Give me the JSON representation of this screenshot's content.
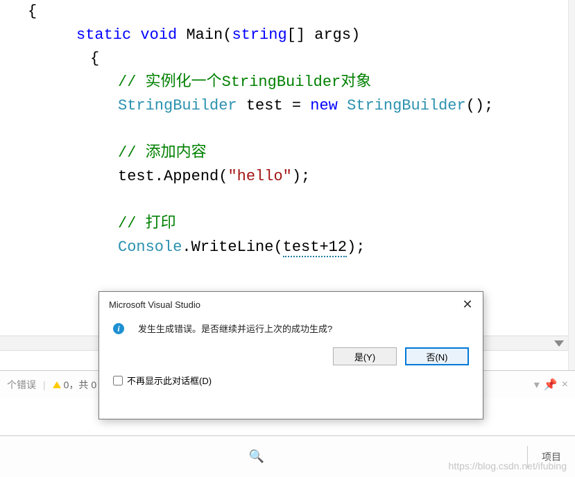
{
  "code": {
    "l1": "{",
    "kw_static": "static",
    "kw_void": "void",
    "fn_main": "Main",
    "kw_string": "string",
    "args": "args",
    "l3": "{",
    "c1": "// 实例化一个StringBuilder对象",
    "sb_type": "StringBuilder",
    "var_test": "test",
    "op_eq": " = ",
    "kw_new": "new",
    "sb_ctor": "StringBuilder",
    "c2": "// 添加内容",
    "test_append_pre": "test.Append(",
    "str_hello": "\"hello\"",
    "c3": "// 打印",
    "console_type": "Console",
    "writeline": ".WriteLine(",
    "expr_arg": "test+12",
    "close": ");"
  },
  "dialog": {
    "title": "Microsoft Visual Studio",
    "message": "发生生成错误。是否继续并运行上次的成功生成?",
    "yes": "是(Y)",
    "no": "否(N)",
    "checkbox": "不再显示此对话框(D)"
  },
  "statusbar": {
    "err_label": "个错误",
    "warn_label": "0，共 0"
  },
  "shelf": {
    "tab1": "项目"
  },
  "watermark": "https://blog.csdn.net/ifubing"
}
